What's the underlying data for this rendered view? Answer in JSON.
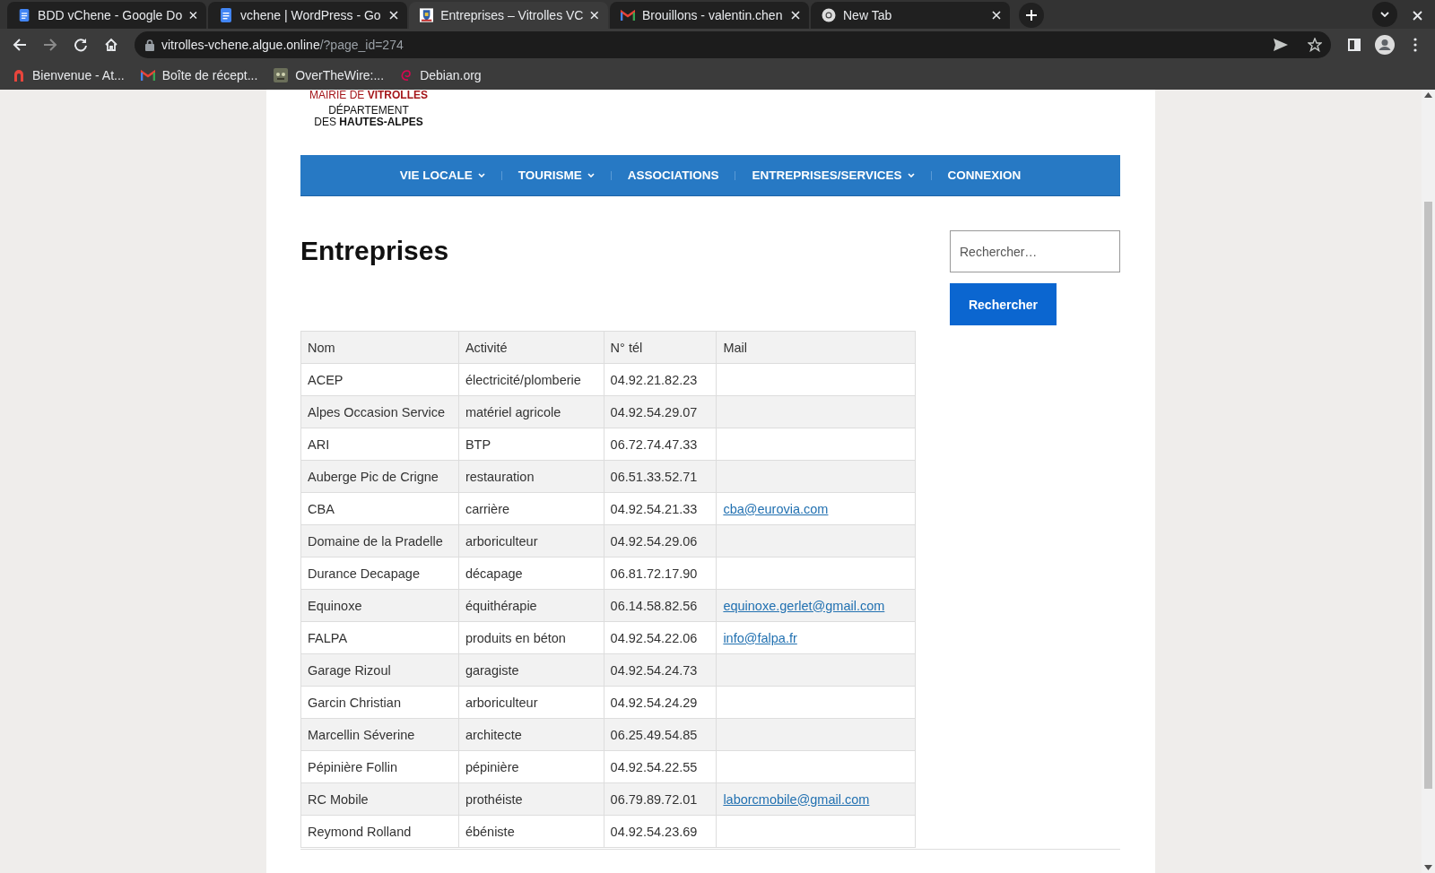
{
  "browser": {
    "tabs": [
      {
        "title": "BDD vChene - Google Do",
        "kind": "docs",
        "selected": false
      },
      {
        "title": "vchene | WordPress - Go",
        "kind": "docs",
        "selected": false
      },
      {
        "title": "Entreprises – Vitrolles VC",
        "kind": "site",
        "selected": true
      },
      {
        "title": "Brouillons - valentin.chen",
        "kind": "gmail",
        "selected": false
      },
      {
        "title": "New Tab",
        "kind": "chrome",
        "selected": false
      }
    ],
    "address": {
      "host": "vitrolles-vchene.algue.online",
      "path": "/?page_id=274"
    },
    "bookmarks": [
      {
        "label": "Bienvenue - At...",
        "kind": "arch"
      },
      {
        "label": "Boîte de récept...",
        "kind": "gmail"
      },
      {
        "label": "OverTheWire:...",
        "kind": "otw"
      },
      {
        "label": "Debian.org",
        "kind": "debian"
      }
    ]
  },
  "site": {
    "logo": {
      "line_1": "MAIRIE DE **VITROLLES**",
      "line_2": "DÉPARTEMENT",
      "line_3": "DES **HAUTES-ALPES**"
    },
    "nav": [
      {
        "label": "VIE LOCALE",
        "dropdown": true
      },
      {
        "label": "TOURISME",
        "dropdown": true
      },
      {
        "label": "ASSOCIATIONS",
        "dropdown": false
      },
      {
        "label": "ENTREPRISES/SERVICES",
        "dropdown": true
      },
      {
        "label": "CONNEXION",
        "dropdown": false
      }
    ],
    "title": "Entreprises",
    "search": {
      "placeholder": "Rechercher…",
      "button": "Rechercher"
    },
    "table": {
      "columns": [
        "Nom",
        "Activité",
        "N° tél",
        "Mail"
      ],
      "rows": [
        {
          "name": "ACEP",
          "activity": "électricité/plomberie",
          "phone": "04.92.21.82.23"
        },
        {
          "name": "Alpes Occasion Service",
          "activity": "matériel agricole",
          "phone": "04.92.54.29.07"
        },
        {
          "name": "ARI",
          "activity": "BTP",
          "phone": "06.72.74.47.33"
        },
        {
          "name": "Auberge Pic de Crigne",
          "activity": "restauration",
          "phone": "06.51.33.52.71"
        },
        {
          "name": "CBA",
          "activity": "carrière",
          "phone": "04.92.54.21.33",
          "mail": "cba@eurovia.com"
        },
        {
          "name": "Domaine de la Pradelle",
          "activity": "arboriculteur",
          "phone": "04.92.54.29.06"
        },
        {
          "name": "Durance Decapage",
          "activity": "décapage",
          "phone": "06.81.72.17.90"
        },
        {
          "name": "Equinoxe",
          "activity": "équithérapie",
          "phone": "06.14.58.82.56",
          "mail": "equinoxe.gerlet@gmail.com"
        },
        {
          "name": "FALPA",
          "activity": "produits en béton",
          "phone": "04.92.54.22.06",
          "mail": "info@falpa.fr"
        },
        {
          "name": "Garage Rizoul",
          "activity": "garagiste",
          "phone": "04.92.54.24.73"
        },
        {
          "name": "Garcin Christian",
          "activity": "arboriculteur",
          "phone": "04.92.54.24.29"
        },
        {
          "name": "Marcellin Séverine",
          "activity": "architecte",
          "phone": "06.25.49.54.85"
        },
        {
          "name": "Pépinière Follin",
          "activity": "pépinière",
          "phone": "04.92.54.22.55"
        },
        {
          "name": "RC Mobile",
          "activity": "prothéiste",
          "phone": "06.79.89.72.01",
          "mail": "laborcmobile@gmail.com"
        },
        {
          "name": "Reymond Rolland",
          "activity": "ébéniste",
          "phone": "04.92.54.23.69"
        }
      ]
    }
  }
}
